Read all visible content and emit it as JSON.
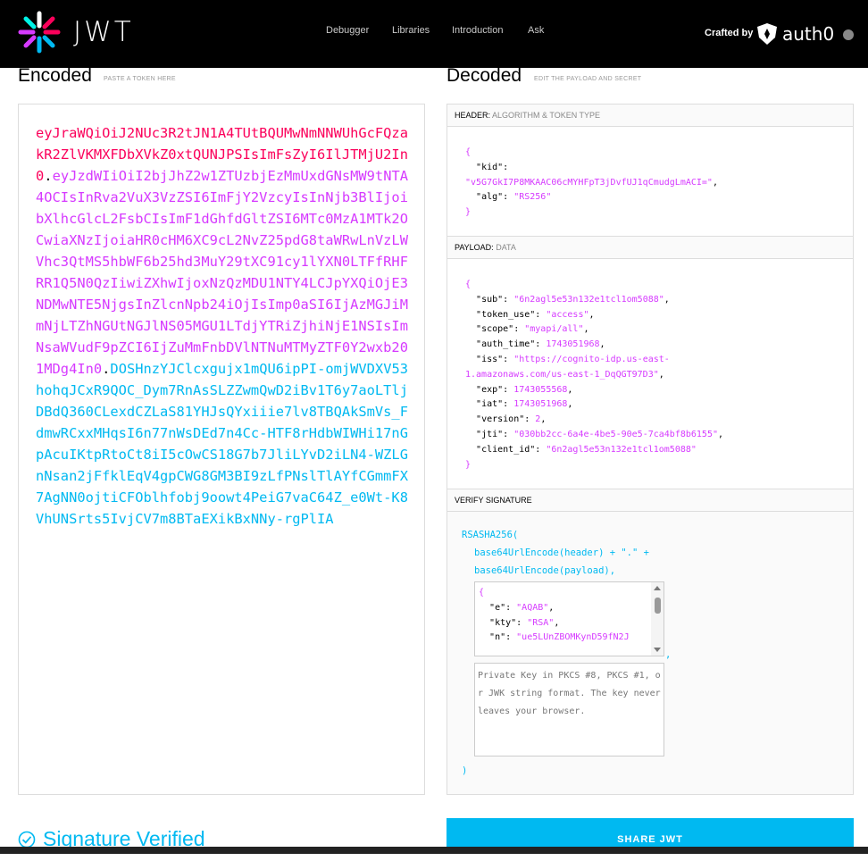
{
  "nav": {
    "brand": "JWT",
    "links": [
      "Debugger",
      "Libraries",
      "Introduction",
      "Ask"
    ],
    "crafted_by": "Crafted by",
    "partner": "auth0"
  },
  "encoded": {
    "title": "Encoded",
    "subtitle": "PASTE A TOKEN HERE",
    "header_part": "eyJraWQiOiJ2NUc3R2tJN1A4TUtBQUMwNmNNWUhGcFQzakR2ZlVKMXFDbXVkZ0xtQUNJPSIsImFsZyI6IlJTMjU2In0",
    "payload_part": "eyJzdWIiOiI2bjJhZ2w1ZTUzbjEzMmUxdGNsMW9tNTA4OCIsInRva2VuX3VzZSI6ImFjY2VzcyIsInNjb3BlIjoibXlhcGlcL2FsbCIsImF1dGhfdGltZSI6MTc0MzA1MTk2OCwiaXNzIjoiaHR0cHM6XC9cL2NvZ25pdG8taWRwLnVzLWVhc3QtMS5hbWF6b25hd3MuY29tXC91cy1lYXN0LTFfRHFRR1Q5N0QzIiwiZXhwIjoxNzQzMDU1NTY4LCJpYXQiOjE3NDMwNTE5NjgsInZlcnNpb24iOjIsImp0aSI6IjAzMGJiMmNjLTZhNGUtNGJlNS05MGU1LTdjYTRiZjhiNjE1NSIsImNsaWVudF9pZCI6IjZuMmFnbDVlNTNuMTMyZTF0Y2wxb201MDg4In0",
    "signature_part": "DOSHnzYJClcxgujx1mQU6ipPI-omjWVDXV53hohqJCxR9QOC_Dym7RnAsSLZZwmQwD2iBv1T6y7aoLTljDBdQ360CLexdCZLaS81YHJsQYxiiie7lv8TBQAkSmVs_FdmwRCxxMHqsI6n77nWsDEd7n4Cc-HTF8rHdbWIWHi17nGpAcuIKtpRtoCt8iI5cOwCS18G7b7JliLYvD2iLN4-WZLGnNsan2jFfklEqV4gpCWG8GM3BI9zLfPNslTlAYfCGmmFX7AgNN0ojtiCFOblhfobj9oowt4PeiG7vaC64Z_e0Wt-K8VhUNSrts5IvjCV7m8BTaEXikBxNNy-rgPlIA",
    "dot": "."
  },
  "decoded": {
    "title": "Decoded",
    "subtitle": "EDIT THE PAYLOAD AND SECRET",
    "header_section": {
      "label": "HEADER:",
      "sub": "ALGORITHM & TOKEN TYPE"
    },
    "payload_section": {
      "label": "PAYLOAD:",
      "sub": "DATA"
    },
    "verify_section": {
      "label": "VERIFY SIGNATURE"
    },
    "header_lines": [
      "{",
      "  \"kid\":",
      "\"v5G7GkI7P8MKAAC06cMYHFpT3jDvfUJ1qCmudgLmACI=\",",
      "  \"alg\": \"RS256\"",
      "}"
    ],
    "payload_lines": [
      "{",
      "  \"sub\": \"6n2agl5e53n132e1tcl1om5088\",",
      "  \"token_use\": \"access\",",
      "  \"scope\": \"myapi/all\",",
      "  \"auth_time\": 1743051968,",
      "  \"iss\": \"https://cognito-idp.us-east-",
      "1.amazonaws.com/us-east-1_DqQGT97D3\",",
      "  \"exp\": 1743055568,",
      "  \"iat\": 1743051968,",
      "  \"version\": 2,",
      "  \"jti\": \"030bb2cc-6a4e-4be5-90e5-7ca4bf8b6155\",",
      "  \"client_id\": \"6n2agl5e53n132e1tcl1om5088\"",
      "}"
    ],
    "verify": {
      "fn": "RSASHA256(",
      "line1": "base64UrlEncode(header) + \".\" +",
      "line2": "base64UrlEncode(payload),",
      "jwk_lines": [
        "{",
        "  \"e\": \"AQAB\",",
        "  \"kty\": \"RSA\",",
        "  \"n\": \"ue5LUnZBOMKynD59fN2J"
      ],
      "comma": ",",
      "private_key_placeholder": "Private Key in PKCS #8, PKCS #1, or JWK string format. The key never leaves your browser.",
      "close": ")"
    }
  },
  "status": {
    "verified_text": "Signature Verified",
    "share_label": "SHARE JWT"
  },
  "colors": {
    "header": "#fb015b",
    "payload": "#d63aff",
    "signature": "#00b9f1"
  }
}
